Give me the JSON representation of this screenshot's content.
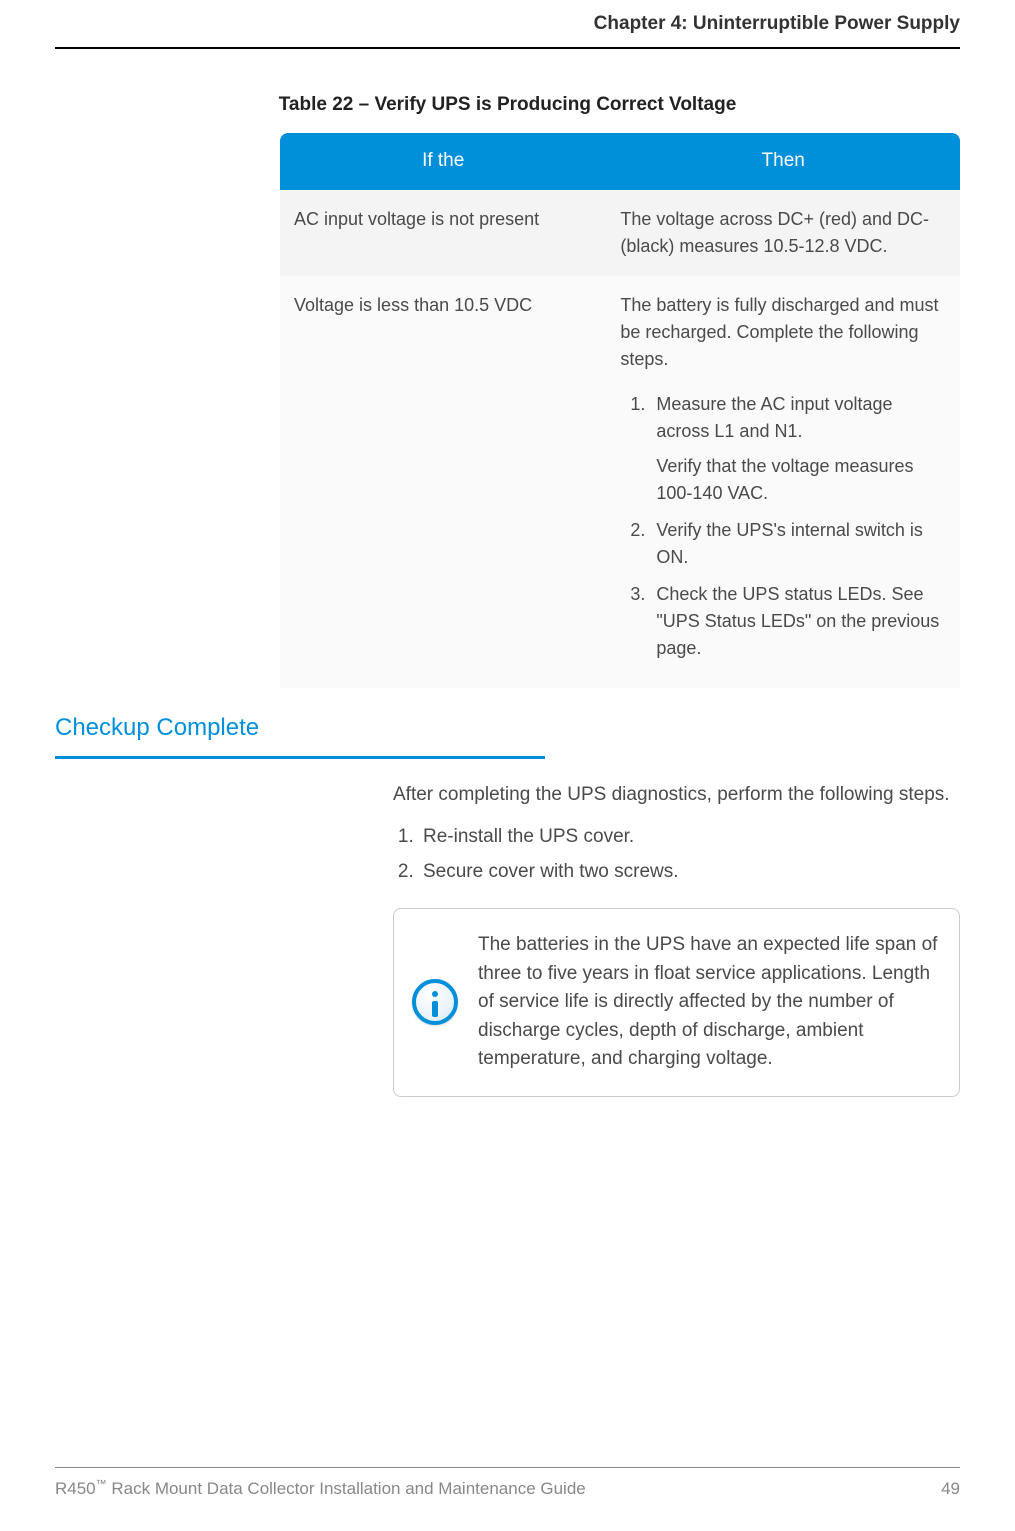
{
  "header": {
    "chapter": "Chapter 4: Uninterruptible Power Supply"
  },
  "table": {
    "caption": "Table 22  –  Verify UPS is Producing Correct Voltage",
    "headers": [
      "If the",
      "Then"
    ],
    "rows": [
      {
        "if": "AC input voltage is not present",
        "then": "The voltage across DC+ (red) and DC- (black) measures 10.5-12.8 VDC."
      },
      {
        "if": "Voltage is less than 10.5 VDC",
        "then_intro": "The battery is fully discharged and must be recharged. Complete the following steps.",
        "steps": [
          {
            "text": "Measure the AC input voltage across L1 and N1.",
            "sub": "Verify that the voltage measures 100-140 VAC."
          },
          {
            "text": "Verify the UPS's internal switch is ON."
          },
          {
            "text": "Check the UPS status LEDs. See \"UPS Status LEDs\" on the previous page."
          }
        ]
      }
    ]
  },
  "section": {
    "heading": "Checkup Complete",
    "intro": "After completing the UPS diagnostics, perform the following steps.",
    "steps": [
      "Re-install the UPS cover.",
      "Secure cover with two screws."
    ],
    "info": "The batteries in the UPS have an expected life span of three to five years in float service applications. Length of service life is directly affected by the number of discharge cycles, depth of discharge, ambient temperature, and charging voltage."
  },
  "footer": {
    "product": "R450",
    "tm": "™",
    "title_rest": " Rack Mount Data Collector Installation and Maintenance Guide",
    "page": "49"
  }
}
